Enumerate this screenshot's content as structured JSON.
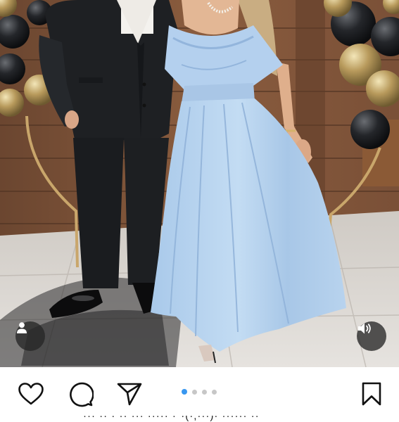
{
  "post": {
    "media": {
      "carousel": {
        "total": 4,
        "active_index": 0
      },
      "overlays": {
        "user_tag_icon": "person-icon",
        "audio_icon": "speaker-muted-icon"
      }
    },
    "actions": {
      "like_icon": "heart-icon",
      "comment_icon": "speech-bubble-icon",
      "share_icon": "paper-plane-icon",
      "save_icon": "bookmark-icon"
    },
    "caption_peek": "··· ·· · ·· ··· ····· ·\"·(·,···)· ······ ··\"",
    "colors": {
      "dot_active": "#3897f0",
      "dot_inactive": "#c7c7c7",
      "overlay_button_bg": "#262626"
    }
  }
}
